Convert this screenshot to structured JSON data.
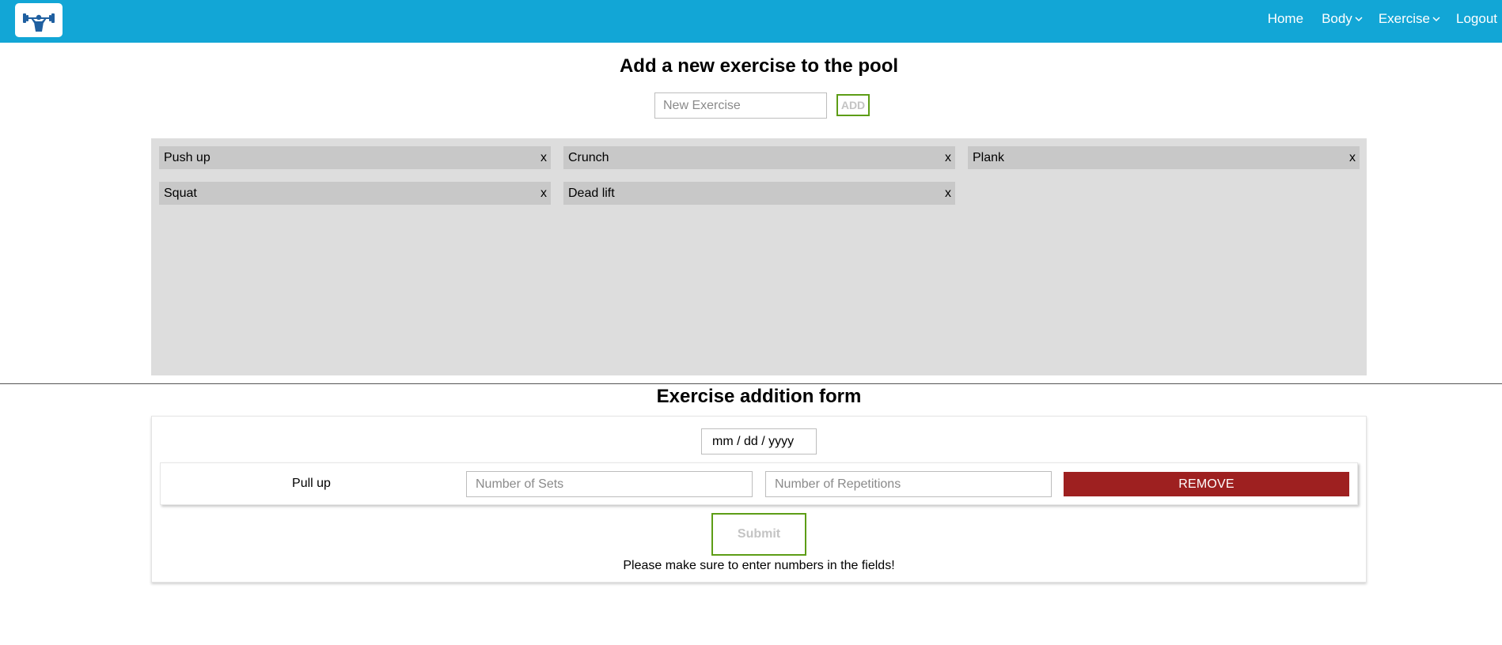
{
  "nav": {
    "logo_icon": "weightlifter-icon",
    "home": "Home",
    "body": "Body",
    "exercise": "Exercise",
    "logout": "Logout",
    "bar_color": "#12a6d6"
  },
  "pool_section": {
    "title": "Add a new exercise to the pool",
    "input_placeholder": "New Exercise",
    "add_label": "ADD",
    "items": [
      {
        "label": "Push up",
        "remove": "x"
      },
      {
        "label": "Crunch",
        "remove": "x"
      },
      {
        "label": "Plank",
        "remove": "x"
      },
      {
        "label": "Squat",
        "remove": "x"
      },
      {
        "label": "Dead lift",
        "remove": "x"
      }
    ]
  },
  "form_section": {
    "title": "Exercise addition form",
    "date_placeholder": "mm / dd / yyyy",
    "row": {
      "exercise": "Pull up",
      "sets_placeholder": "Number of Sets",
      "reps_placeholder": "Number of Repetitions",
      "remove_label": "REMOVE"
    },
    "submit_label": "Submit",
    "hint": "Please make sure to enter numbers in the fields!",
    "accent_color": "#5d9d16",
    "danger_color": "#9e2020"
  }
}
